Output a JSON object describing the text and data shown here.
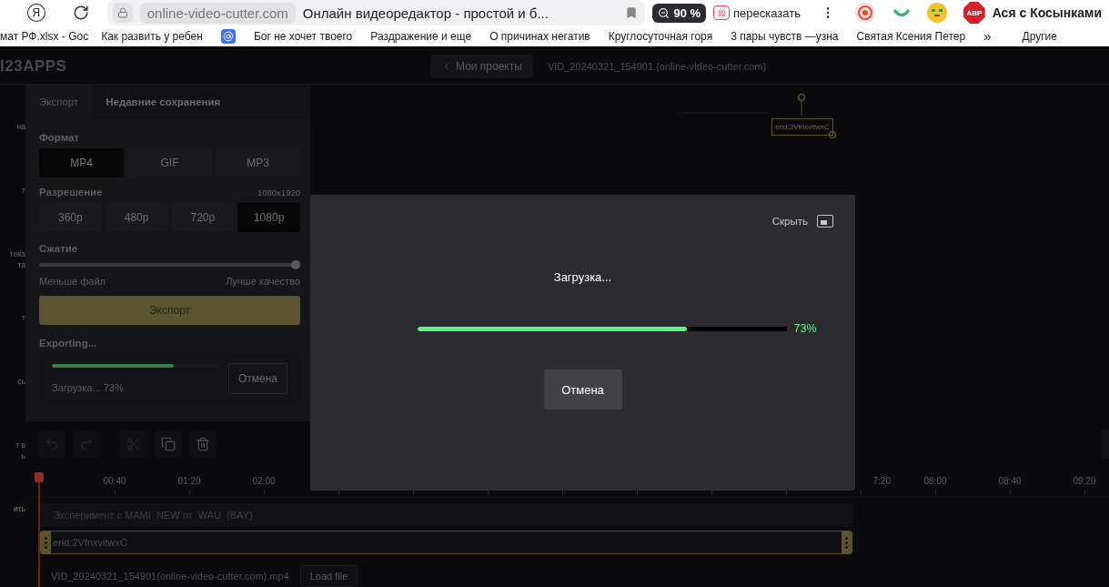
{
  "browser": {
    "home": "Я",
    "url": "online-video-cutter.com",
    "page_title": "Онлайн видеоредактор - простой и б...",
    "zoom": "90 %",
    "summarize": "пересказать",
    "adblock": "ABP",
    "profile": "Ася с Косынками"
  },
  "bookmarks": {
    "items": [
      {
        "kind": "text",
        "label": "мат РФ.xlsx - Goc"
      },
      {
        "kind": "text",
        "label": "Как развить у ребен"
      },
      {
        "kind": "mail"
      },
      {
        "kind": "text",
        "label": "Бог не хочет твоего"
      },
      {
        "kind": "text",
        "label": "Раздражение и еще"
      },
      {
        "kind": "text",
        "label": "О причинах негатив"
      },
      {
        "kind": "text",
        "label": "Круглосуточная горя"
      },
      {
        "kind": "text",
        "label": "3 пары чувств —узна"
      },
      {
        "kind": "text",
        "label": "Святая Ксения Петер"
      }
    ],
    "more": "»",
    "other": "Другие"
  },
  "header": {
    "logo": "I23APPS",
    "back_button": "Мои проекты",
    "file_title": "VID_20240321_154901 (online-video-cutter.com)"
  },
  "sidebar": [
    {
      "lines": [
        "на"
      ],
      "selected": false
    },
    {
      "lines": [
        "т"
      ],
      "selected": false
    },
    {
      "lines": [
        "тека",
        "та"
      ],
      "selected": false
    },
    {
      "lines": [
        "т"
      ],
      "selected": false
    },
    {
      "lines": [
        "сь"
      ],
      "selected": false
    },
    {
      "lines": [
        "т в",
        "ь"
      ],
      "selected": false
    },
    {
      "lines": [
        "ить"
      ],
      "selected": true
    }
  ],
  "export_panel": {
    "tabs": [
      {
        "label": "Экспорт",
        "selected": true
      },
      {
        "label": "Недавние сохранения",
        "selected": false
      }
    ],
    "format": {
      "label": "Формат",
      "options": [
        {
          "label": "MP4",
          "selected": true
        },
        {
          "label": "GIF",
          "selected": false
        },
        {
          "label": "MP3",
          "selected": false
        }
      ]
    },
    "resolution": {
      "label": "Разрешение",
      "size": "1080x1920",
      "options": [
        {
          "label": "360p",
          "selected": false
        },
        {
          "label": "480p",
          "selected": false
        },
        {
          "label": "720p",
          "selected": false
        },
        {
          "label": "1080p",
          "selected": true
        }
      ]
    },
    "compression": {
      "label": "Сжатие",
      "level": 1,
      "min_label": "Меньше файл",
      "max_label": "Лучше качество"
    },
    "export_button": "Экспорт",
    "exporting": {
      "label": "Exporting...",
      "level": 0.73,
      "status": "Загрузка... 73%",
      "cancel": "Отмена"
    }
  },
  "preview": {
    "text_box": "erid:2VfnxvitwxC"
  },
  "toolbar": [
    {
      "kind": "undo",
      "disabled": true
    },
    {
      "kind": "redo",
      "disabled": true
    },
    {
      "kind": "cut",
      "disabled": true
    },
    {
      "kind": "copy",
      "disabled": false
    },
    {
      "kind": "delete",
      "disabled": false
    }
  ],
  "timeline": {
    "ticks": [
      {
        "kind": "label",
        "label": "00:40"
      },
      {
        "kind": "label",
        "label": "01:20"
      },
      {
        "kind": "label",
        "label": "02:00"
      },
      {
        "kind": "mark"
      },
      {
        "kind": "mark"
      },
      {
        "kind": "mark"
      },
      {
        "kind": "mark"
      },
      {
        "kind": "mark"
      },
      {
        "kind": "mark"
      },
      {
        "kind": "mark"
      },
      {
        "kind": "cut",
        "label": "7:20"
      },
      {
        "kind": "label",
        "label": "08:00"
      },
      {
        "kind": "label",
        "label": "08:40"
      },
      {
        "kind": "label",
        "label": "09:20"
      }
    ],
    "text_track": "Эксперимент с MAMI  NEW от  WAU  (BAY)",
    "ticker_clip": "erid:2VfnxvitwxC",
    "video_track": "VID_20240321_154901(online-video-cutter.com).mp4",
    "load_button": "Load file"
  },
  "modal": {
    "hide": "Скрыть",
    "status": "Загрузка...",
    "level": 0.73,
    "percent": "73%",
    "cancel": "Отмена"
  }
}
